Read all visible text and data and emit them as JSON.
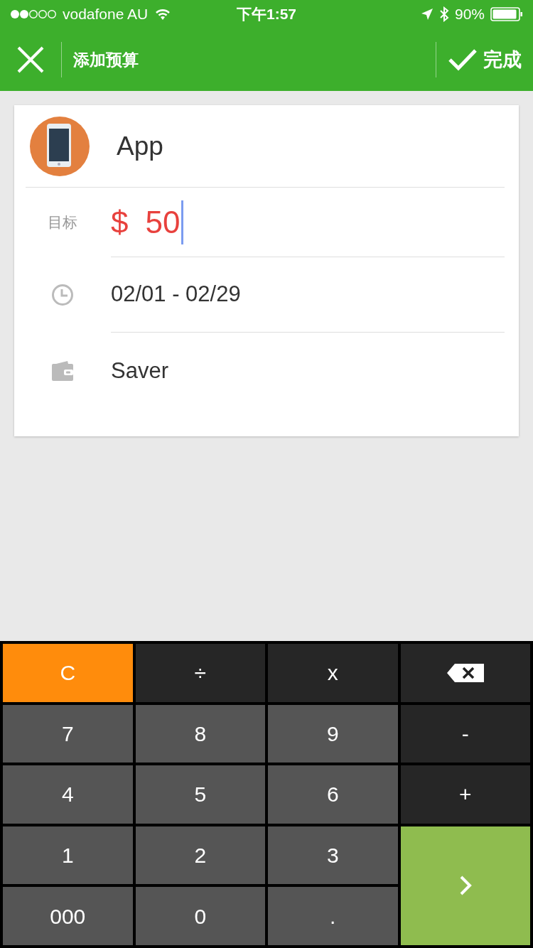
{
  "status_bar": {
    "carrier": "vodafone AU",
    "time": "下午1:57",
    "battery": "90%"
  },
  "header": {
    "title": "添加预算",
    "done": "完成"
  },
  "budget": {
    "category": "App",
    "target_label": "目标",
    "currency": "$",
    "amount": "50",
    "period": "02/01 - 02/29",
    "account": "Saver"
  },
  "keypad": [
    {
      "kind": "clear",
      "label": "C"
    },
    {
      "kind": "op",
      "label": "÷"
    },
    {
      "kind": "op",
      "label": "x"
    },
    {
      "kind": "backspace"
    },
    {
      "kind": "digit",
      "label": "7"
    },
    {
      "kind": "digit",
      "label": "8"
    },
    {
      "kind": "digit",
      "label": "9"
    },
    {
      "kind": "op",
      "label": "-"
    },
    {
      "kind": "digit",
      "label": "4"
    },
    {
      "kind": "digit",
      "label": "5"
    },
    {
      "kind": "digit",
      "label": "6"
    },
    {
      "kind": "op",
      "label": "+"
    },
    {
      "kind": "digit",
      "label": "1"
    },
    {
      "kind": "digit",
      "label": "2"
    },
    {
      "kind": "digit",
      "label": "3"
    },
    {
      "kind": "enter"
    },
    {
      "kind": "digit",
      "label": "000"
    },
    {
      "kind": "digit",
      "label": "0"
    },
    {
      "kind": "digit",
      "label": "."
    }
  ]
}
